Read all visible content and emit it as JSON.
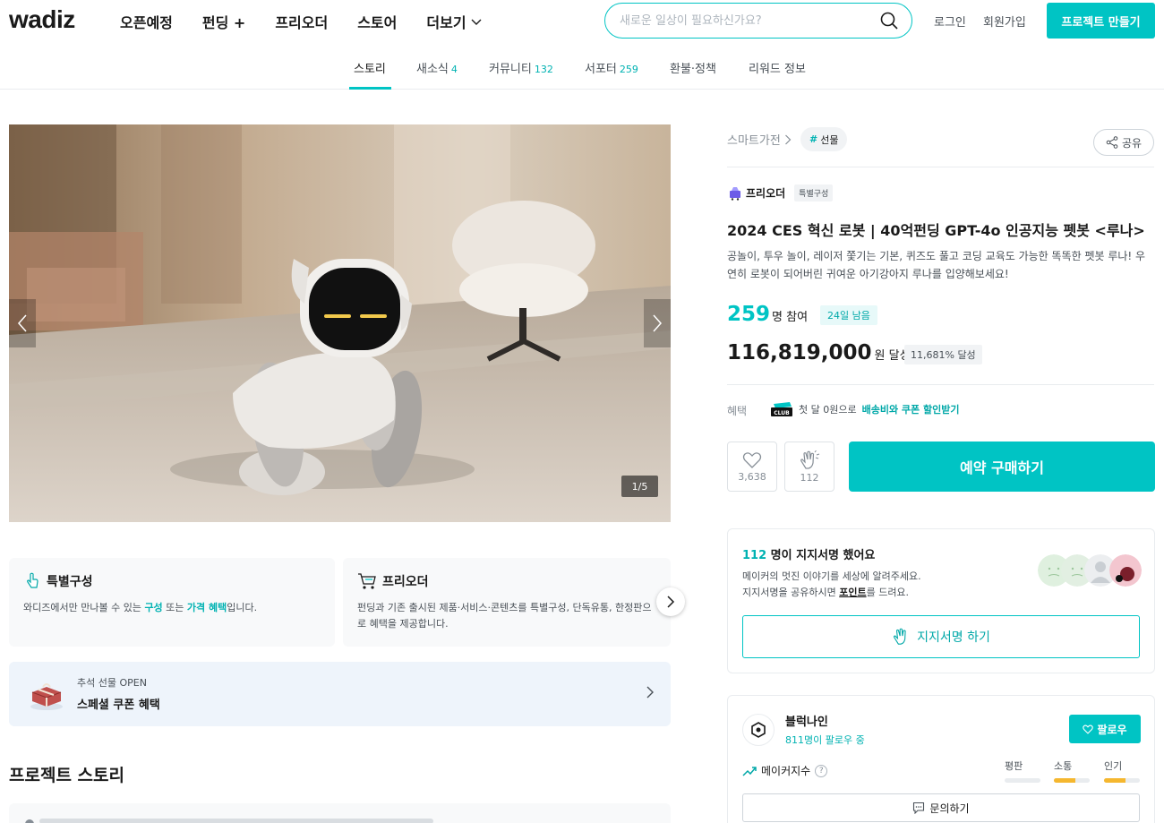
{
  "header": {
    "logo": "wadiz",
    "nav": [
      "오픈예정",
      "펀딩 +",
      "프리오더",
      "스토어",
      "더보기"
    ],
    "search_placeholder": "새로운 일상이 필요하신가요?",
    "login": "로그인",
    "signup": "회원가입",
    "make_project": "프로젝트 만들기"
  },
  "tabs": [
    {
      "label": "스토리",
      "count": ""
    },
    {
      "label": "새소식",
      "count": "4"
    },
    {
      "label": "커뮤니티",
      "count": "132"
    },
    {
      "label": "서포터",
      "count": "259"
    },
    {
      "label": "환불·정책",
      "count": ""
    },
    {
      "label": "리워드 정보",
      "count": ""
    }
  ],
  "gallery": {
    "counter": "1/5"
  },
  "cards": [
    {
      "title": "특별구성",
      "desc_pre": "와디즈에서만 만나볼 수 있는 ",
      "desc_hl1": "구성",
      "desc_mid": " 또는 ",
      "desc_hl2": "가격 혜택",
      "desc_post": "입니다."
    },
    {
      "title": "프리오더",
      "desc": "펀딩과 기존 출시된 제품·서비스·콘텐츠를 특별구성, 단독유통, 한정판으로 혜택을 제공합니다."
    }
  ],
  "coupon": {
    "sub": "추석 선물 OPEN",
    "title": "스페셜 쿠폰 혜택"
  },
  "story": {
    "title": "프로젝트 스토리"
  },
  "product": {
    "category": "스마트가전",
    "tag": "선물",
    "share": "공유",
    "type": "프리오더",
    "type_badge": "특별구성",
    "title": "2024 CES 혁신 로봇 | 40억펀딩 GPT-4o 인공지능 펫봇 <루나>",
    "description": "공놀이, 투우 놀이, 레이저 쫓기는 기본, 퀴즈도 풀고 코딩 교육도 가능한 똑똑한 펫봇 루나! 우연히 로봇이 되어버린 귀여운 아기강아지 루나를 입양해보세요!",
    "participants": "259",
    "participants_unit": "명 참여",
    "days_left": "24일 남음",
    "amount": "116,819,000",
    "amount_unit": "원 달성",
    "achieve_rate": "11,681% 달성",
    "benefit_label": "혜택",
    "club_text": "첫 달 0원으로 ",
    "club_strong": "배송비와 쿠폰 할인받기",
    "likes": "3,638",
    "cheers": "112",
    "buy": "예약 구매하기"
  },
  "signature": {
    "count": "112",
    "title_rest": " 명이 지지서명 했어요",
    "desc1": "메이커의 멋진 이야기를 세상에 알려주세요.",
    "desc2_pre": "지지서명을 공유하시면 ",
    "desc2_link": "포인트",
    "desc2_post": "를 드려요.",
    "button": "지지서명 하기"
  },
  "maker": {
    "name": "블럭나인",
    "followers": "811명이 팔로우 중",
    "follow": "팔로우",
    "index_label": "메이커지수",
    "metrics": [
      {
        "label": "평판",
        "fill": 0
      },
      {
        "label": "소통",
        "fill": 0.6
      },
      {
        "label": "인기",
        "fill": 0.6
      }
    ],
    "ask": "문의하기"
  }
}
